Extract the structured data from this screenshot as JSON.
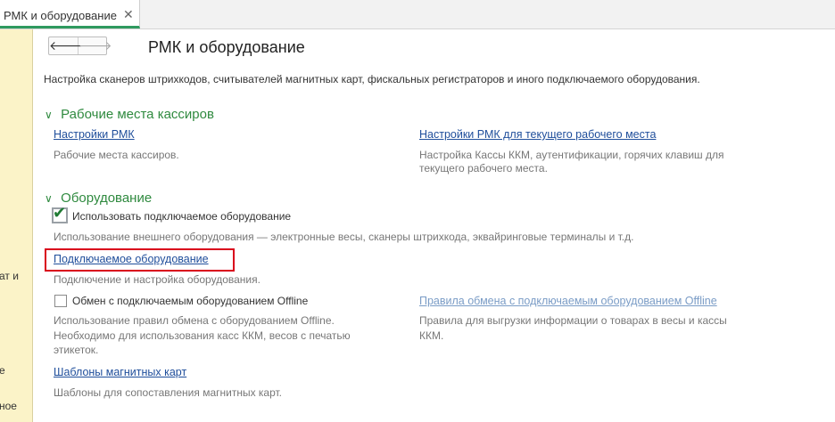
{
  "tab": {
    "label": "РМК и оборудование",
    "close": "✕"
  },
  "left_panel": {
    "fragments": [
      "ат и",
      "е",
      "ное"
    ]
  },
  "nav": {
    "back": "🡐",
    "forward": "🡒"
  },
  "page": {
    "title": "РМК и оборудование",
    "description": "Настройка сканеров штрихкодов, считывателей магнитных карт, фискальных регистраторов и иного подключаемого оборудования."
  },
  "groups": {
    "cashiers": {
      "title": "Рабочие места кассиров",
      "left_link": "Настройки РМК",
      "left_hint": "Рабочие места кассиров.",
      "right_link": "Настройки РМК для текущего рабочего места",
      "right_hint_1": "Настройка Кассы ККМ, аутентификации, горячих клавиш для",
      "right_hint_2": "текущего рабочего места."
    },
    "equipment": {
      "title": "Оборудование",
      "use_equipment_label": "Использовать подключаемое оборудование",
      "use_equipment_checked": true,
      "use_equipment_hint": "Использование внешнего оборудования — электронные весы, сканеры штрихкода, эквайринговые терминалы и т.д.",
      "connected_link": "Подключаемое оборудование",
      "connected_hint": "Подключение и настройка оборудования.",
      "offline_label": "Обмен с подключаемым оборудованием Offline",
      "offline_checked": false,
      "offline_hint_1": "Использование правил обмена с оборудованием Offline.",
      "offline_hint_2": "Необходимо для использования касс ККМ, весов с печатью",
      "offline_hint_3": "этикеток.",
      "offline_rules_link": "Правила обмена с подключаемым оборудованием Offline",
      "offline_rules_hint_1": "Правила для выгрузки информации о товарах в весы и кассы",
      "offline_rules_hint_2": "ККМ.",
      "magnetic_link": "Шаблоны магнитных карт",
      "magnetic_hint": "Шаблоны для сопоставления магнитных карт."
    }
  },
  "colors": {
    "accent_green": "#2f8a3f",
    "link_blue": "#1f4e9b",
    "highlight_red": "#d9001b",
    "left_panel": "#fbf3c8"
  }
}
